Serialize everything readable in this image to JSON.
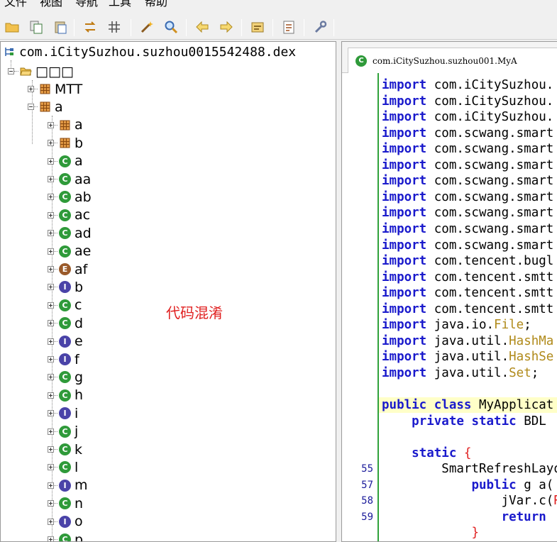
{
  "menubar": {
    "items": [
      "文件",
      "视图",
      "导航",
      "工具",
      "帮助"
    ]
  },
  "toolbar": {
    "icons": [
      "open-folder-icon",
      "copy-icon",
      "paste-icon",
      "sync-icon",
      "grid-icon",
      "wand-icon",
      "search-icon",
      "back-icon",
      "forward-icon",
      "decompile-icon",
      "log-icon",
      "settings-icon"
    ]
  },
  "tree": {
    "root": "com.iCitySuzhou.suzhou0015542488.dex",
    "source_folder": "□□□",
    "nodes": [
      {
        "label": "MTT",
        "type": "package",
        "expanded": false,
        "level": 1
      },
      {
        "label": "a",
        "type": "package",
        "expanded": true,
        "level": 1
      },
      {
        "label": "a",
        "type": "package",
        "expanded": false,
        "level": 2
      },
      {
        "label": "b",
        "type": "package",
        "expanded": false,
        "level": 2
      },
      {
        "label": "a",
        "type": "class",
        "expanded": false,
        "level": 2
      },
      {
        "label": "aa",
        "type": "class",
        "expanded": false,
        "level": 2
      },
      {
        "label": "ab",
        "type": "class",
        "expanded": false,
        "level": 2
      },
      {
        "label": "ac",
        "type": "class",
        "expanded": false,
        "level": 2
      },
      {
        "label": "ad",
        "type": "class",
        "expanded": false,
        "level": 2
      },
      {
        "label": "ae",
        "type": "class",
        "expanded": false,
        "level": 2
      },
      {
        "label": "af",
        "type": "enum",
        "expanded": false,
        "level": 2
      },
      {
        "label": "b",
        "type": "interface",
        "expanded": false,
        "level": 2
      },
      {
        "label": "c",
        "type": "class",
        "expanded": false,
        "level": 2
      },
      {
        "label": "d",
        "type": "class",
        "expanded": false,
        "level": 2
      },
      {
        "label": "e",
        "type": "interface",
        "expanded": false,
        "level": 2
      },
      {
        "label": "f",
        "type": "interface",
        "expanded": false,
        "level": 2
      },
      {
        "label": "g",
        "type": "class",
        "expanded": false,
        "level": 2
      },
      {
        "label": "h",
        "type": "class",
        "expanded": false,
        "level": 2
      },
      {
        "label": "i",
        "type": "interface",
        "expanded": false,
        "level": 2
      },
      {
        "label": "j",
        "type": "class",
        "expanded": false,
        "level": 2
      },
      {
        "label": "k",
        "type": "class",
        "expanded": false,
        "level": 2
      },
      {
        "label": "l",
        "type": "class",
        "expanded": false,
        "level": 2
      },
      {
        "label": "m",
        "type": "interface",
        "expanded": false,
        "level": 2
      },
      {
        "label": "n",
        "type": "class",
        "expanded": false,
        "level": 2
      },
      {
        "label": "o",
        "type": "interface",
        "expanded": false,
        "level": 2
      },
      {
        "label": "p",
        "type": "class",
        "expanded": false,
        "level": 2
      }
    ],
    "icon_letters": {
      "class": "C",
      "interface": "I",
      "enum": "E"
    }
  },
  "annotation": "代码混淆",
  "editor": {
    "tab_title": "com.iCitySuzhou.suzhou001.MyA",
    "lines": [
      {
        "num": "",
        "tokens": [
          [
            "kw",
            "import"
          ],
          [
            "",
            " com.iCitySuzhou."
          ]
        ]
      },
      {
        "num": "",
        "tokens": [
          [
            "kw",
            "import"
          ],
          [
            "",
            " com.iCitySuzhou."
          ]
        ]
      },
      {
        "num": "",
        "tokens": [
          [
            "kw",
            "import"
          ],
          [
            "",
            " com.iCitySuzhou."
          ]
        ]
      },
      {
        "num": "",
        "tokens": [
          [
            "kw",
            "import"
          ],
          [
            "",
            " com.scwang.smart"
          ]
        ]
      },
      {
        "num": "",
        "tokens": [
          [
            "kw",
            "import"
          ],
          [
            "",
            " com.scwang.smart"
          ]
        ]
      },
      {
        "num": "",
        "tokens": [
          [
            "kw",
            "import"
          ],
          [
            "",
            " com.scwang.smart"
          ]
        ]
      },
      {
        "num": "",
        "tokens": [
          [
            "kw",
            "import"
          ],
          [
            "",
            " com.scwang.smart"
          ]
        ]
      },
      {
        "num": "",
        "tokens": [
          [
            "kw",
            "import"
          ],
          [
            "",
            " com.scwang.smart"
          ]
        ]
      },
      {
        "num": "",
        "tokens": [
          [
            "kw",
            "import"
          ],
          [
            "",
            " com.scwang.smart"
          ]
        ]
      },
      {
        "num": "",
        "tokens": [
          [
            "kw",
            "import"
          ],
          [
            "",
            " com.scwang.smart"
          ]
        ]
      },
      {
        "num": "",
        "tokens": [
          [
            "kw",
            "import"
          ],
          [
            "",
            " com.scwang.smart"
          ]
        ]
      },
      {
        "num": "",
        "tokens": [
          [
            "kw",
            "import"
          ],
          [
            "",
            " com.tencent.bugl"
          ]
        ]
      },
      {
        "num": "",
        "tokens": [
          [
            "kw",
            "import"
          ],
          [
            "",
            " com.tencent.smtt"
          ]
        ]
      },
      {
        "num": "",
        "tokens": [
          [
            "kw",
            "import"
          ],
          [
            "",
            " com.tencent.smtt"
          ]
        ]
      },
      {
        "num": "",
        "tokens": [
          [
            "kw",
            "import"
          ],
          [
            "",
            " com.tencent.smtt"
          ]
        ]
      },
      {
        "num": "",
        "tokens": [
          [
            "kw",
            "import"
          ],
          [
            "",
            " java.io."
          ],
          [
            "ty",
            "File"
          ],
          [
            "",
            ";"
          ]
        ]
      },
      {
        "num": "",
        "tokens": [
          [
            "kw",
            "import"
          ],
          [
            "",
            " java.util."
          ],
          [
            "ty",
            "HashMa"
          ]
        ]
      },
      {
        "num": "",
        "tokens": [
          [
            "kw",
            "import"
          ],
          [
            "",
            " java.util."
          ],
          [
            "ty",
            "HashSe"
          ]
        ]
      },
      {
        "num": "",
        "tokens": [
          [
            "kw",
            "import"
          ],
          [
            "",
            " java.util."
          ],
          [
            "ty",
            "Set"
          ],
          [
            "",
            ";"
          ]
        ]
      },
      {
        "num": "",
        "tokens": []
      },
      {
        "num": "",
        "tokens": [
          [
            "kw",
            "public class"
          ],
          [
            "",
            " MyApplicat"
          ]
        ],
        "highlight": true
      },
      {
        "num": "",
        "tokens": [
          [
            "",
            "    "
          ],
          [
            "kw",
            "private static"
          ],
          [
            "",
            " BDL"
          ]
        ]
      },
      {
        "num": "",
        "tokens": []
      },
      {
        "num": "",
        "tokens": [
          [
            "",
            "    "
          ],
          [
            "kw",
            "static"
          ],
          [
            "",
            " "
          ],
          [
            "br",
            "{"
          ]
        ]
      },
      {
        "num": "55",
        "tokens": [
          [
            "",
            "        SmartRefreshLayo"
          ]
        ]
      },
      {
        "num": "57",
        "tokens": [
          [
            "",
            "            "
          ],
          [
            "kw",
            "public"
          ],
          [
            "",
            " g a("
          ]
        ]
      },
      {
        "num": "58",
        "tokens": [
          [
            "",
            "                jVar.c("
          ],
          [
            "br",
            "R"
          ]
        ]
      },
      {
        "num": "59",
        "tokens": [
          [
            "",
            "                "
          ],
          [
            "kw",
            "return"
          ]
        ]
      },
      {
        "num": "",
        "tokens": [
          [
            "",
            "            "
          ],
          [
            "br",
            "}"
          ]
        ]
      }
    ]
  }
}
